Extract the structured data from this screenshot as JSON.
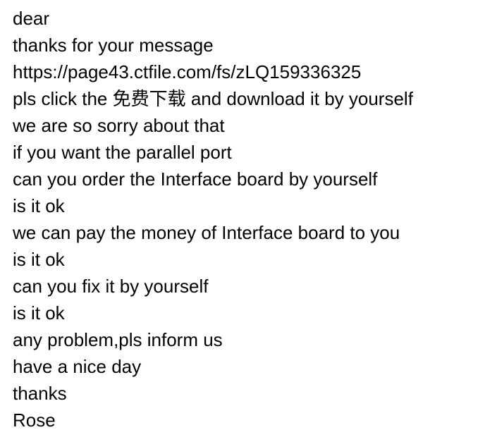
{
  "message": {
    "lines": [
      "dear",
      "thanks for your message",
      "https://page43.ctfile.com/fs/zLQ159336325",
      "pls click the 免费下载 and download it by yourself",
      "we are so sorry about that",
      "if you want the parallel port",
      "can you order the Interface board by yourself",
      "is it ok",
      "we can pay the money of Interface board to you",
      "is it ok",
      "can you fix it by yourself",
      "is it ok",
      "any problem,pls inform us",
      "have a nice day",
      "thanks",
      "Rose"
    ]
  }
}
